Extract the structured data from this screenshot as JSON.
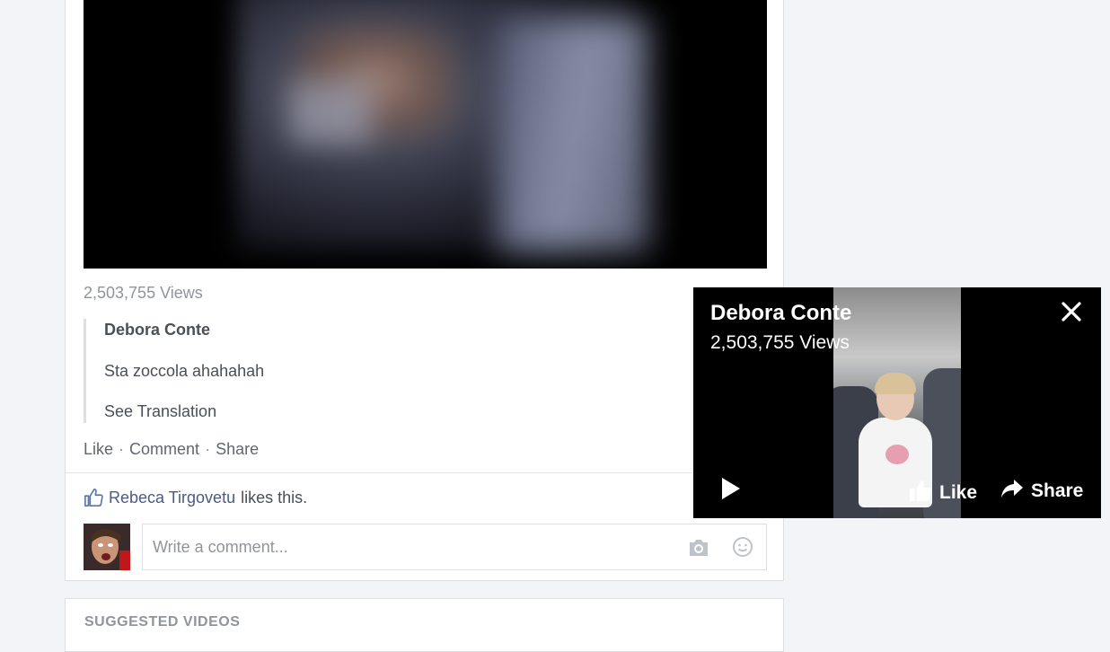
{
  "post": {
    "views": "2,503,755 Views",
    "comment": {
      "author": "Debora Conte",
      "text": "Sta zoccola ahahahah",
      "translation_link": "See Translation"
    },
    "actions": {
      "like": "Like",
      "comment": "Comment",
      "share": "Share",
      "separator": "·"
    },
    "likes": {
      "name": "Rebeca Tirgovetu",
      "suffix": "likes this."
    },
    "comment_input": {
      "placeholder": "Write a comment..."
    },
    "icons": [
      "thumbs-up-icon",
      "camera-icon",
      "smiley-icon",
      "avatar"
    ]
  },
  "suggested": {
    "heading": "SUGGESTED VIDEOS"
  },
  "mini_player": {
    "title": "Debora Conte",
    "views": "2,503,755 Views",
    "like_label": "Like",
    "share_label": "Share",
    "icons": [
      "close-icon",
      "play-icon",
      "thumbs-up-icon",
      "share-arrow-icon"
    ]
  },
  "colors": {
    "background": "#f3f4f8",
    "link": "#4b5a82",
    "muted": "#90949c",
    "text": "#4b4f56"
  }
}
